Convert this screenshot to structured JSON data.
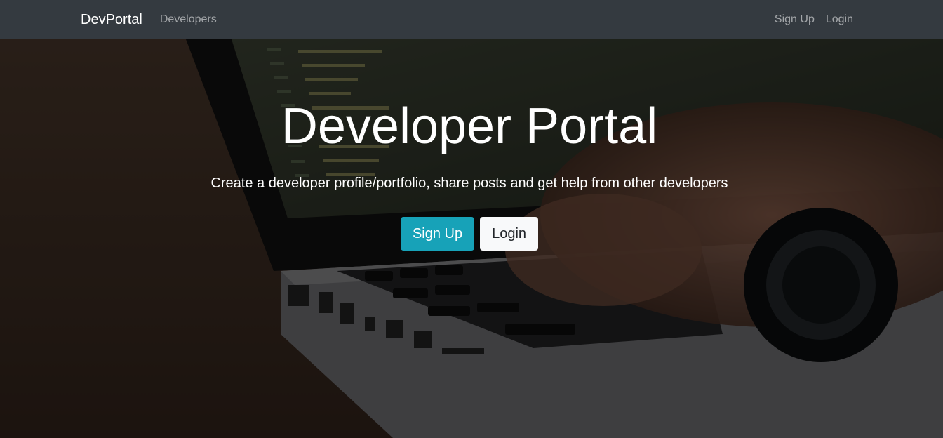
{
  "navbar": {
    "brand": "DevPortal",
    "links": [
      "Developers"
    ],
    "right_links": [
      "Sign Up",
      "Login"
    ]
  },
  "hero": {
    "title": "Developer Portal",
    "lead": "Create a developer profile/portfolio, share posts and get help from other developers",
    "buttons": [
      {
        "label": "Sign Up",
        "style": "info"
      },
      {
        "label": "Login",
        "style": "light"
      }
    ]
  },
  "colors": {
    "navbar_bg": "#343a40",
    "primary_button": "#17a2b8",
    "secondary_button": "#f8f9fa"
  }
}
